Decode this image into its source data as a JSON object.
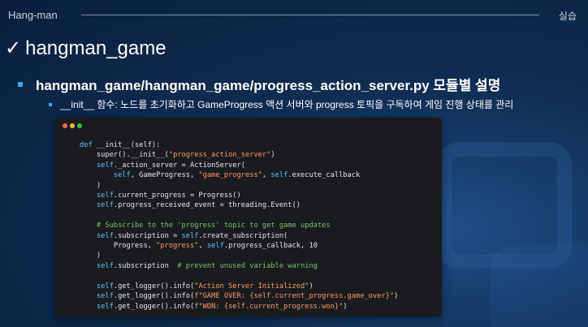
{
  "header": {
    "left_title": "Hang-man",
    "right_label": "실습"
  },
  "title": {
    "text": "hangman_game"
  },
  "bullet_level1": {
    "text": "hangman_game/hangman_game/progress_action_server.py 모듈별 설명"
  },
  "bullet_level2": {
    "text": "__init__ 함수: 노드를 초기화하고 GameProgress 액션 서버와 progress 토픽을 구독하여 게임 진행 상태를 관리"
  },
  "colors": {
    "accent": "#3fa9f5",
    "dot_red": "#ff5f57",
    "dot_yellow": "#febc2e",
    "dot_green": "#28c840"
  },
  "code": {
    "lines": [
      [
        {
          "t": "def",
          "c": "kw"
        },
        {
          "t": " __init__(self):"
        }
      ],
      [
        {
          "t": "    super().__init__("
        },
        {
          "t": "\"progress_action_server\"",
          "c": "str"
        },
        {
          "t": ")"
        }
      ],
      [
        {
          "t": "    "
        },
        {
          "t": "self",
          "c": "kw"
        },
        {
          "t": "._action_server = ActionServer("
        }
      ],
      [
        {
          "t": "        "
        },
        {
          "t": "self",
          "c": "kw"
        },
        {
          "t": ", GameProgress, "
        },
        {
          "t": "\"game_progress\"",
          "c": "str"
        },
        {
          "t": ", "
        },
        {
          "t": "self",
          "c": "kw"
        },
        {
          "t": ".execute_callback"
        }
      ],
      [
        {
          "t": "    )"
        }
      ],
      [
        {
          "t": "    "
        },
        {
          "t": "self",
          "c": "kw"
        },
        {
          "t": ".current_progress = Progress()"
        }
      ],
      [
        {
          "t": "    "
        },
        {
          "t": "self",
          "c": "kw"
        },
        {
          "t": ".progress_received_event = threading.Event()"
        }
      ],
      [],
      [
        {
          "t": "    "
        },
        {
          "t": "# Subscribe to the 'progress' topic to get game updates",
          "c": "cmt"
        }
      ],
      [
        {
          "t": "    "
        },
        {
          "t": "self",
          "c": "kw"
        },
        {
          "t": ".subscription = "
        },
        {
          "t": "self",
          "c": "kw"
        },
        {
          "t": ".create_subscription("
        }
      ],
      [
        {
          "t": "        Progress, "
        },
        {
          "t": "\"progress\"",
          "c": "str"
        },
        {
          "t": ", "
        },
        {
          "t": "self",
          "c": "kw"
        },
        {
          "t": ".progress_callback, 10"
        }
      ],
      [
        {
          "t": "    )"
        }
      ],
      [
        {
          "t": "    "
        },
        {
          "t": "self",
          "c": "kw"
        },
        {
          "t": ".subscription  "
        },
        {
          "t": "# prevent unused variable warning",
          "c": "cmt"
        }
      ],
      [],
      [
        {
          "t": "    "
        },
        {
          "t": "self",
          "c": "kw"
        },
        {
          "t": ".get_logger().info("
        },
        {
          "t": "\"Action Server Initialized\"",
          "c": "str"
        },
        {
          "t": ")"
        }
      ],
      [
        {
          "t": "    "
        },
        {
          "t": "self",
          "c": "kw"
        },
        {
          "t": ".get_logger().info("
        },
        {
          "t": "f\"GAME OVER: {self.current_progress.game_over}\"",
          "c": "str"
        },
        {
          "t": ")"
        }
      ],
      [
        {
          "t": "    "
        },
        {
          "t": "self",
          "c": "kw"
        },
        {
          "t": ".get_logger().info("
        },
        {
          "t": "f\"WON: {self.current_progress.won}\"",
          "c": "str"
        },
        {
          "t": ")"
        }
      ]
    ]
  }
}
